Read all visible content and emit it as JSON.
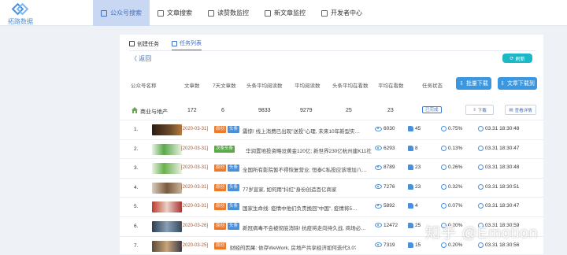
{
  "logo": {
    "text": "拓路数据"
  },
  "nav": [
    {
      "label": "公众号搜索",
      "active": true
    },
    {
      "label": "文章搜索"
    },
    {
      "label": "读赞数监控"
    },
    {
      "label": "新文章监控"
    },
    {
      "label": "开发者中心"
    }
  ],
  "subtabs": {
    "create": "创建任务",
    "list": "任务列表"
  },
  "back": "〈 返回",
  "refresh": "刷新",
  "headers": {
    "name": "公众号名称",
    "articles": "文章数",
    "articles7": "7天文章数",
    "head_read": "头条平均阅读数",
    "avg_read": "平均阅读数",
    "head_like": "头条平均在看数",
    "avg_like": "平均在看数",
    "status": "任务状态"
  },
  "buttons": {
    "batch_download": "批量下载",
    "batch_export": "文章下载到"
  },
  "summary": {
    "name": "商业与地产",
    "articles": "172",
    "articles7": "6",
    "head_read": "9833",
    "avg_read": "9279",
    "head_like": "25",
    "avg_like": "23",
    "status": "已完成",
    "download": "下载",
    "detail": "查看详情"
  },
  "rows": [
    {
      "idx": "1.",
      "date": "[2020-03-31]",
      "tag": "原创",
      "tag2": "头条",
      "title": "震惊! 线上消费已出现\"送投\"心理, 未来10年新型实…",
      "reads": "6030",
      "likes": "45",
      "rate": "0.75%",
      "time": "03.31 18:30:48"
    },
    {
      "idx": "2.",
      "date": "[2020-03-31]",
      "tag": "次条头条",
      "tag2": "",
      "title": "华润置地投资略设黄金120亿; 新世界230亿杭州建K11社…",
      "reads": "6293",
      "likes": "8",
      "rate": "0.13%",
      "time": "03.31 18:30:47"
    },
    {
      "idx": "3.",
      "date": "[2020-03-31]",
      "tag": "原创",
      "tag2": "头条",
      "title": "全国所有影院暂不得恢复营业; 恒泰C私投应该增加八…",
      "reads": "8789",
      "likes": "23",
      "rate": "0.26%",
      "time": "03.31 18:30:48"
    },
    {
      "idx": "4.",
      "date": "[2020-03-31]",
      "tag": "原创",
      "tag2": "头条",
      "title": "77岁宣家, 如何用\"抖红\"身份创造百亿商家",
      "reads": "7276",
      "likes": "23",
      "rate": "0.32%",
      "time": "03.31 18:30:51"
    },
    {
      "idx": "5.",
      "date": "[2020-03-31]",
      "tag": "原创",
      "tag2": "头条",
      "title": "国家生命线: 疫情中他们负责挽回\"中国\", 疫情将5…",
      "reads": "5892",
      "likes": "4",
      "rate": "0.07%",
      "time": "03.31 18:30:47"
    },
    {
      "idx": "6.",
      "date": "[2020-03-26]",
      "tag": "原创",
      "tag2": "头条",
      "title": "新冠病毒不会被彻底消除! 抗疫将走向持久战, 商场必…",
      "reads": "12472",
      "likes": "25",
      "rate": "0.20%",
      "time": "03.31 18:30:59"
    },
    {
      "idx": "7.",
      "date": "[2020-03-25]",
      "tag": "原创",
      "tag2": "",
      "title": "财经的因果: 依存WeWork, 房地产共享经济如何迭代3.0?",
      "reads": "7319",
      "likes": "15",
      "rate": "0.20%",
      "time": "03.31 18:30:56"
    }
  ],
  "watermark": "知乎 @Emotion",
  "colors": {
    "accent": "#3b97e0",
    "tag_orange": "#ec7a2a",
    "tag_green": "#5aa84a",
    "date": "#a35a3a"
  }
}
